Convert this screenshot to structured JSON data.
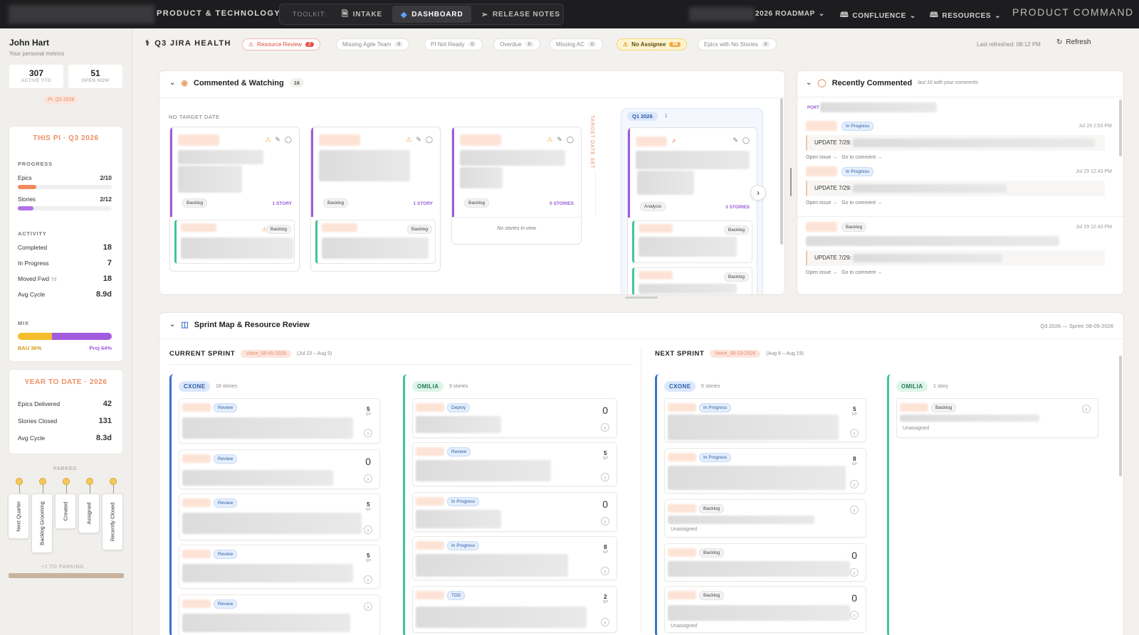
{
  "topbar": {
    "brand": "PRODUCT & TECHNOLOGY",
    "toolkit_label": "TOOLKIT:",
    "buttons": [
      {
        "label": "INTAKE",
        "icon": "document-icon"
      },
      {
        "label": "DASHBOARD",
        "icon": "diamond-icon",
        "active": true
      },
      {
        "label": "RELEASE NOTES",
        "icon": "send-icon"
      }
    ],
    "nav": [
      {
        "label": "2026 ROADMAP"
      },
      {
        "label": "CONFLUENCE"
      },
      {
        "label": "RESOURCES"
      }
    ],
    "title": "PRODUCT COMMAND"
  },
  "sidebar": {
    "user_name": "John Hart",
    "user_sub": "Your personal metrics",
    "stats": [
      {
        "value": "307",
        "label": "ACTIVE YTD"
      },
      {
        "value": "51",
        "label": "OPEN NOW"
      }
    ],
    "pi_pill": "PI: Q3 2026",
    "this_pi": {
      "title": "THIS PI · Q3 2026",
      "progress_label": "PROGRESS",
      "epics_label": "Epics",
      "epics_value": "2/10",
      "epics_fraction": 0.2,
      "stories_label": "Stories",
      "stories_value": "2/12",
      "stories_fraction": 0.1667,
      "activity_label": "ACTIVITY",
      "activity": [
        {
          "label": "Completed",
          "value": "18"
        },
        {
          "label": "In Progress",
          "value": "7"
        },
        {
          "label": "Moved Fwd",
          "suffix": "7d",
          "value": "18"
        },
        {
          "label": "Avg Cycle",
          "value": "8.9d"
        }
      ],
      "mix_label": "MIX",
      "bau_label": "BAU 36%",
      "proj_label": "Proj 64%",
      "bau_fraction": 0.36
    },
    "ytd": {
      "title": "YEAR TO DATE · 2026",
      "rows": [
        {
          "label": "Epics Delivered",
          "value": "42"
        },
        {
          "label": "Stories Closed",
          "value": "131"
        },
        {
          "label": "Avg Cycle",
          "value": "8.3d"
        }
      ]
    },
    "parked_label": "PARKED",
    "parked_tags": [
      "Next Quarter",
      "Backlog Grooming",
      "Created",
      "Assigned",
      "Recently Closed"
    ],
    "parking_foot": "+1 TO PARKING"
  },
  "header": {
    "title": "Q3 JIRA HEALTH",
    "chips": [
      {
        "label": "Resource Review",
        "count": "2"
      },
      {
        "label": "Missing Agile Team",
        "count": "0"
      },
      {
        "label": "PI Not Ready",
        "count": "0"
      },
      {
        "label": "Overdue",
        "count": "0"
      },
      {
        "label": "Missing AC",
        "count": "0"
      },
      {
        "label": "No Assignee",
        "count": "36"
      },
      {
        "label": "Epics with No Stories",
        "count": "0"
      }
    ],
    "last_refreshed": "Last refreshed: 08:12 PM",
    "refresh_label": "Refresh"
  },
  "watching": {
    "title": "Commented & Watching",
    "count": "16",
    "no_target": "NO TARGET DATE",
    "target_set": "TARGET DATE SET",
    "epics": [
      {
        "status": "Backlog",
        "stories": "1 STORY",
        "child_status": "Backlog"
      },
      {
        "status": "Backlog",
        "stories": "1 STORY",
        "child_status": "Backlog"
      },
      {
        "status": "Backlog",
        "stories": "0 STORIES",
        "empty_text": "No stories in view"
      }
    ],
    "q1": {
      "label": "Q1 2026",
      "count": "1",
      "status": "Analysis",
      "stories": "3 STORIES",
      "child_status": "Backlog"
    }
  },
  "recent": {
    "title": "Recently Commented",
    "subtitle": "last 10 with your comments",
    "port_label": "PORT",
    "items": [
      {
        "status": "In Progress",
        "date": "Jul 29 2:53 PM",
        "update": "UPDATE 7/29:"
      },
      {
        "status": "In Progress",
        "date": "Jul 29 12:43 PM",
        "update": "UPDATE 7/29:"
      },
      {
        "status": "Backlog",
        "date": "Jul 29 12:43 PM",
        "update": "UPDATE 7/29:"
      }
    ],
    "open_issue": "Open issue →",
    "go_comment": "Go to comment →"
  },
  "sprint": {
    "title": "Sprint Map & Resource Review",
    "meta": "Q3 2026 — Sprint: 08-05-2026",
    "current": {
      "label": "CURRENT SPRINT",
      "chip": "Voice_08-05-2026",
      "dates": "(Jul 23 – Aug 5)"
    },
    "next": {
      "label": "NEXT SPRINT",
      "chip": "Voice_08-19-2026",
      "dates": "(Aug 6 – Aug 19)"
    },
    "cur_cxone": {
      "team": "CXONE",
      "count": "18 stories",
      "cards": [
        {
          "status": "Review",
          "sp": "5"
        },
        {
          "status": "Review",
          "sp": "0"
        },
        {
          "status": "Review",
          "sp": "5"
        },
        {
          "status": "Review",
          "sp": "5"
        },
        {
          "status": "Review",
          "sp": ""
        }
      ]
    },
    "cur_omilia": {
      "team": "OMILIA",
      "count": "9 stories",
      "cards": [
        {
          "status": "Deploy",
          "sp": "0"
        },
        {
          "status": "Review",
          "sp": "5"
        },
        {
          "status": "In Progress",
          "sp": "0"
        },
        {
          "status": "In Progress",
          "sp": "8"
        },
        {
          "status": "TDD",
          "sp": "2"
        }
      ]
    },
    "next_cxone": {
      "team": "CXONE",
      "count": "5 stories",
      "cards": [
        {
          "status": "In Progress",
          "sp": "5"
        },
        {
          "status": "In Progress",
          "sp": "8"
        },
        {
          "status": "Backlog",
          "sp": "",
          "note": "Unassigned"
        },
        {
          "status": "Backlog",
          "sp": "0"
        },
        {
          "status": "Backlog",
          "sp": "0",
          "note": "Unassigned"
        }
      ]
    },
    "next_omilia": {
      "team": "OMILIA",
      "count": "1 story",
      "cards": [
        {
          "status": "Backlog",
          "note": "Unassigned"
        }
      ]
    },
    "sp_unit": "SP"
  }
}
